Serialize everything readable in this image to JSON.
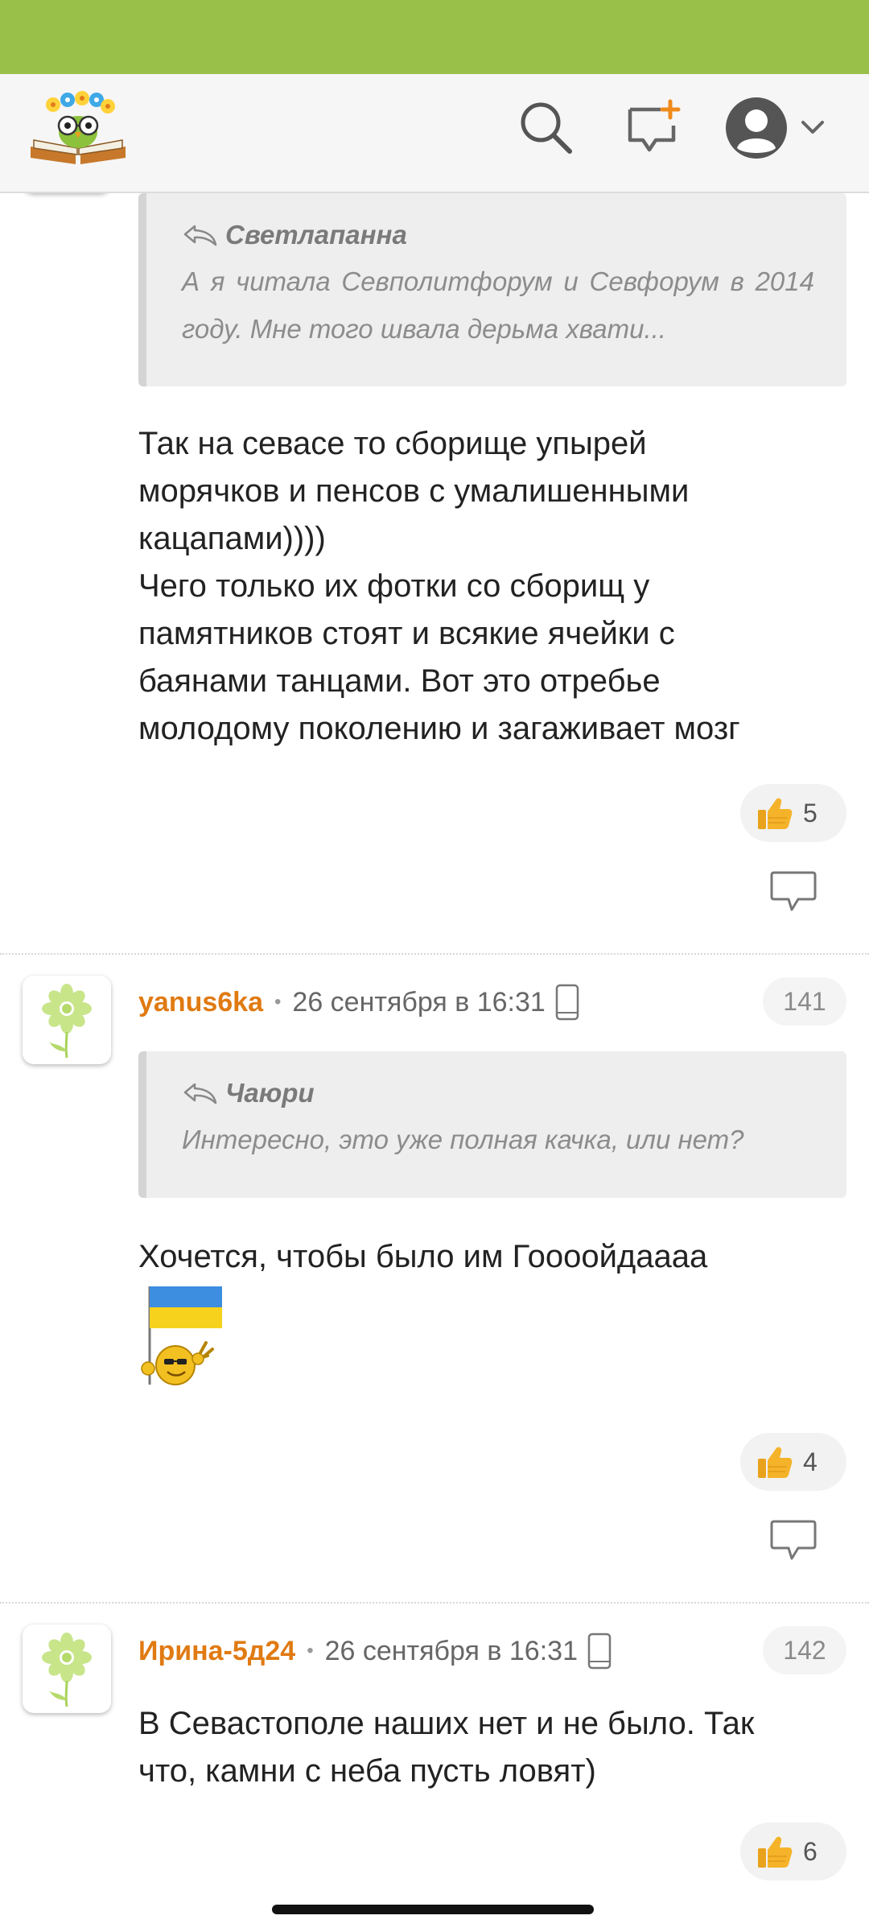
{
  "colors": {
    "status_bar": "#99c14a",
    "author": "#e07a12",
    "quote_bg": "#eeeeee",
    "like_thumb": "#f5b32a"
  },
  "header": {
    "logo": "book-owl-logo",
    "icons": [
      "search-icon",
      "new-post-icon",
      "user-avatar-icon",
      "chevron-down-icon"
    ]
  },
  "comments": [
    {
      "quote": {
        "author": "Светлапанна",
        "text": "А я читала Севполитфорум и Севфорум в 2014 году. Мне того швала дерьма хвати..."
      },
      "lines": [
        "Так на севасе то сборище упырей",
        "морячков и пенсов с умалишенными",
        "кацапами))))",
        "Чего только их фотки со сборищ у",
        "памятников стоят и всякие ячейки с",
        "баянами танцами. Вот это отребье",
        "молодому поколению и загаживает мозг"
      ],
      "likes": "5"
    },
    {
      "author": "yanus6ka",
      "date": "26 сентября в 16:31",
      "number": "141",
      "quote": {
        "author": "Чаюри",
        "text": "Интересно, это уже полная качка, или нет?"
      },
      "lines": [
        "Хочется, чтобы было им Гоооойдаааа"
      ],
      "emoji": "ukraine-flag-smiley",
      "likes": "4"
    },
    {
      "author": "Ирина-5д24",
      "date": "26 сентября в 16:31",
      "number": "142",
      "lines": [
        "В Севастополе наших нет и не было. Так",
        "что, камни с неба пусть ловят)"
      ],
      "likes": "6"
    }
  ]
}
